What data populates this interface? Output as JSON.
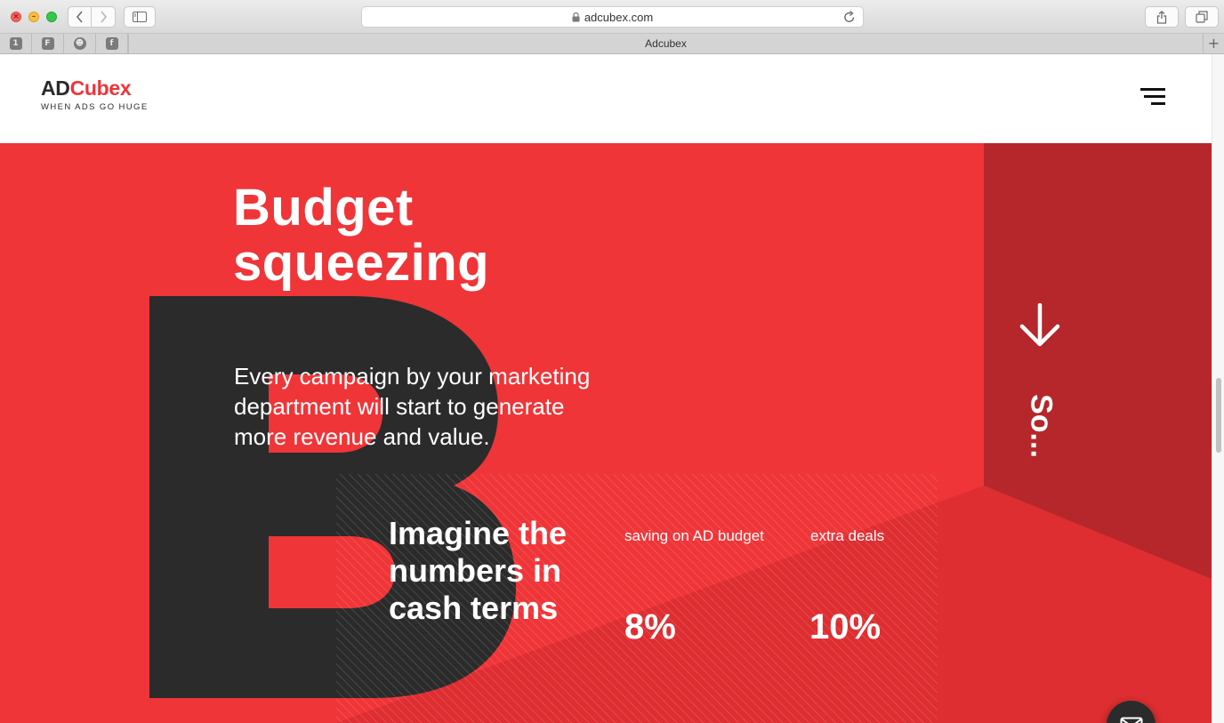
{
  "browser": {
    "url": "adcubex.com",
    "tab_title": "Adcubex",
    "favorites": [
      "1",
      "F",
      "☻",
      "f"
    ],
    "new_tab": "+"
  },
  "header": {
    "logo_ad": "AD",
    "logo_cubex": "Cubex",
    "tagline": "WHEN ADS GO HUGE"
  },
  "hero": {
    "title_line1": "Budget",
    "title_line2": "squeezing",
    "text_line1": "Every campaign by your marketing",
    "text_line2": "department will start to generate",
    "text_line3": "more revenue and value.",
    "cash_line1": "Imagine the",
    "cash_line2": "numbers in",
    "cash_line3": "cash terms",
    "stats": [
      {
        "label": "saving on AD budget",
        "value": "8%"
      },
      {
        "label": "extra deals",
        "value": "10%"
      }
    ],
    "side_text": "So...",
    "big_letter": "B"
  },
  "colors": {
    "brand_red": "#ef3538",
    "dark_red": "#b5272a",
    "dark": "#2b2b2b"
  }
}
